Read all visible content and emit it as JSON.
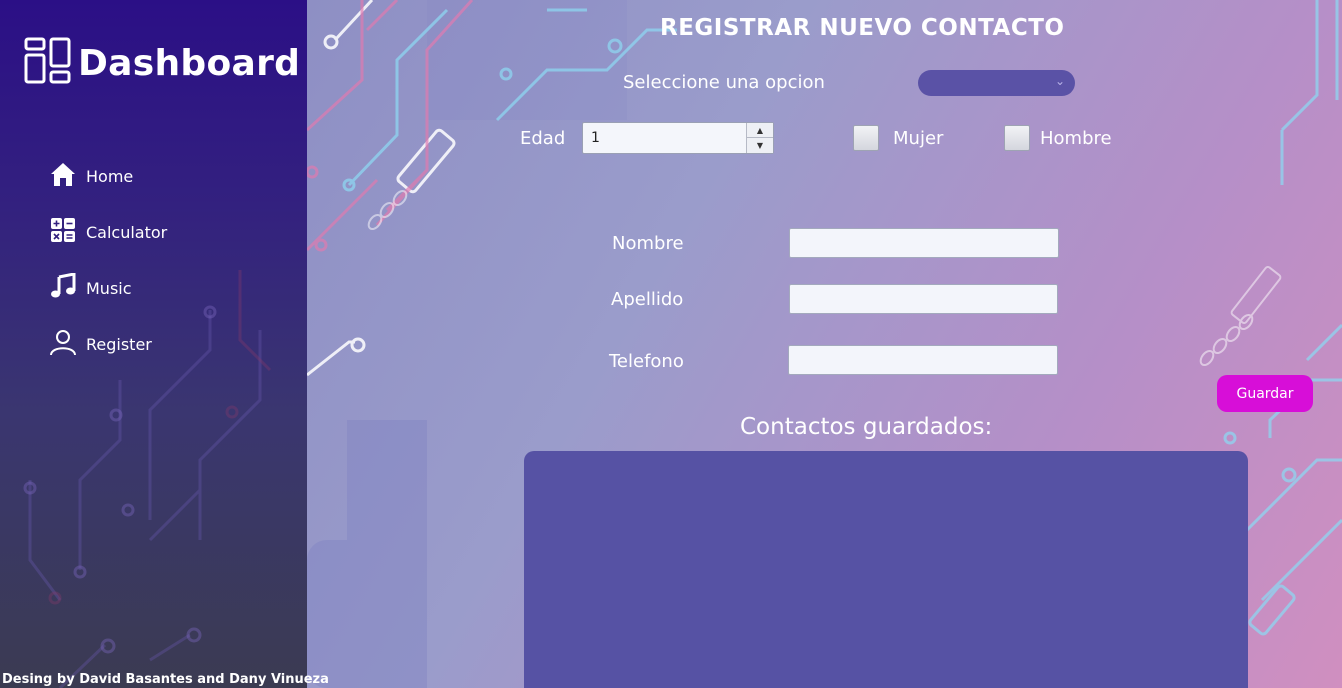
{
  "sidebar": {
    "brand": {
      "title": "Dashboard",
      "icon": "dashboard-icon"
    },
    "items": [
      {
        "label": "Home",
        "icon": "home-icon"
      },
      {
        "label": "Calculator",
        "icon": "calculator-icon"
      },
      {
        "label": "Music",
        "icon": "music-icon"
      },
      {
        "label": "Register",
        "icon": "user-icon"
      }
    ],
    "credit": "Desing by David Basantes and Dany Vinueza"
  },
  "form": {
    "title": "REGISTRAR NUEVO CONTACTO",
    "select_label": "Seleccione una opcion",
    "select_value": "",
    "age_label": "Edad",
    "age_value": "1",
    "gender_female": "Mujer",
    "gender_male": "Hombre",
    "name_label": "Nombre",
    "name_value": "",
    "surname_label": "Apellido",
    "surname_value": "",
    "phone_label": "Telefono",
    "phone_value": "",
    "save_label": "Guardar"
  },
  "saved": {
    "title": "Contactos guardados:",
    "items": []
  },
  "colors": {
    "accent": "#d70ed8",
    "list_bg": "#5652a4",
    "sidebar_top": "#2b0f86"
  }
}
